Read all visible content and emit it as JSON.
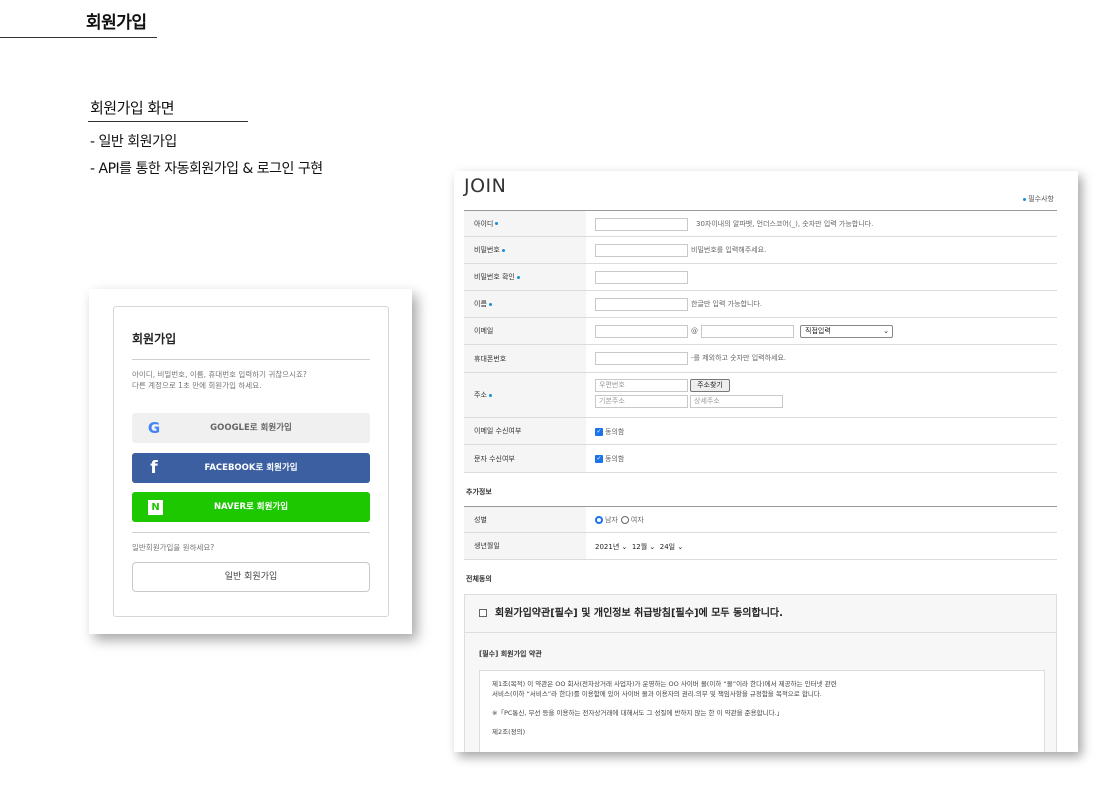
{
  "page": {
    "title": "회원가입",
    "section_title": "회원가입 화면",
    "bullets": [
      "- 일반 회원가입",
      "- API를 통한 자동회원가입 & 로그인 구현"
    ]
  },
  "login_card": {
    "title": "회원가입",
    "desc_line1": "아이디, 비밀번호, 이름, 휴대번호 입력하기 귀찮으시죠?",
    "desc_line2": "다른 계정으로 1초 만에 회원가입 하세요.",
    "google_label": "GOOGLE로 회원가입",
    "facebook_label": "FACEBOOK로 회원가입",
    "naver_label": "NAVER로 회원가입",
    "normal_question": "일반회원가입을 원하세요?",
    "normal_button": "일반 회원가입",
    "colors": {
      "facebook": "#3b5fa0",
      "naver": "#1ec800",
      "google_bg": "#f0f0f0"
    }
  },
  "join_form": {
    "title": "JOIN",
    "required_note": "필수사항",
    "fields": {
      "id_label": "아이디",
      "id_hint": "30자이내의 알파벳, 언더스코어(_), 숫자만 입력 가능합니다.",
      "pw_label": "비밀번호",
      "pw_hint": "비밀번호를 입력해주세요.",
      "pw_confirm_label": "비밀번호 확인",
      "name_label": "이름",
      "name_hint": "한글만 입력 가능합니다.",
      "email_label": "이메일",
      "email_at": "@",
      "email_domain_select": "직접입력",
      "phone_label": "휴대폰번호",
      "phone_hint": "-를 제외하고 숫자만 입력하세요.",
      "address_label": "주소",
      "zip_placeholder": "우편번호",
      "find_address_button": "주소찾기",
      "base_address_placeholder": "기본주소",
      "detail_address_placeholder": "상세주소",
      "email_receive_label": "이메일 수신여부",
      "email_receive_value": "동의함",
      "sms_receive_label": "문자 수신여부",
      "sms_receive_value": "동의함"
    },
    "extra_section": "추가정보",
    "gender_label": "성별",
    "gender_male": "남자",
    "gender_female": "여자",
    "birth_label": "생년월일",
    "birth_year": "2021년",
    "birth_month": "12월",
    "birth_day": "24일",
    "agree_section": "전체동의",
    "agree_all": "회원가입약관[필수] 및 개인정보 취급방침[필수]에 모두 동의합니다.",
    "terms_title": "[필수] 회원가입 약관",
    "terms_line1": "제1조(목적) 이 약관은 OO 회사(전자상거래 사업자)가 운영하는 OO 사이버 몰(이하 “몰”이라 한다)에서 제공하는 인터넷 관련",
    "terms_line2": "서비스(이하 “서비스”라 한다)를 이용함에 있어 사이버 몰과 이용자의 권리.의무 및 책임사항을 규정함을 목적으로 합니다.",
    "terms_line3": "※「PC통신, 무선 등을 이용하는 전자상거래에 대해서도 그 성질에 반하지 않는 한 이 약관을 준용합니다.」",
    "terms_line4": "제2조(정의)"
  }
}
